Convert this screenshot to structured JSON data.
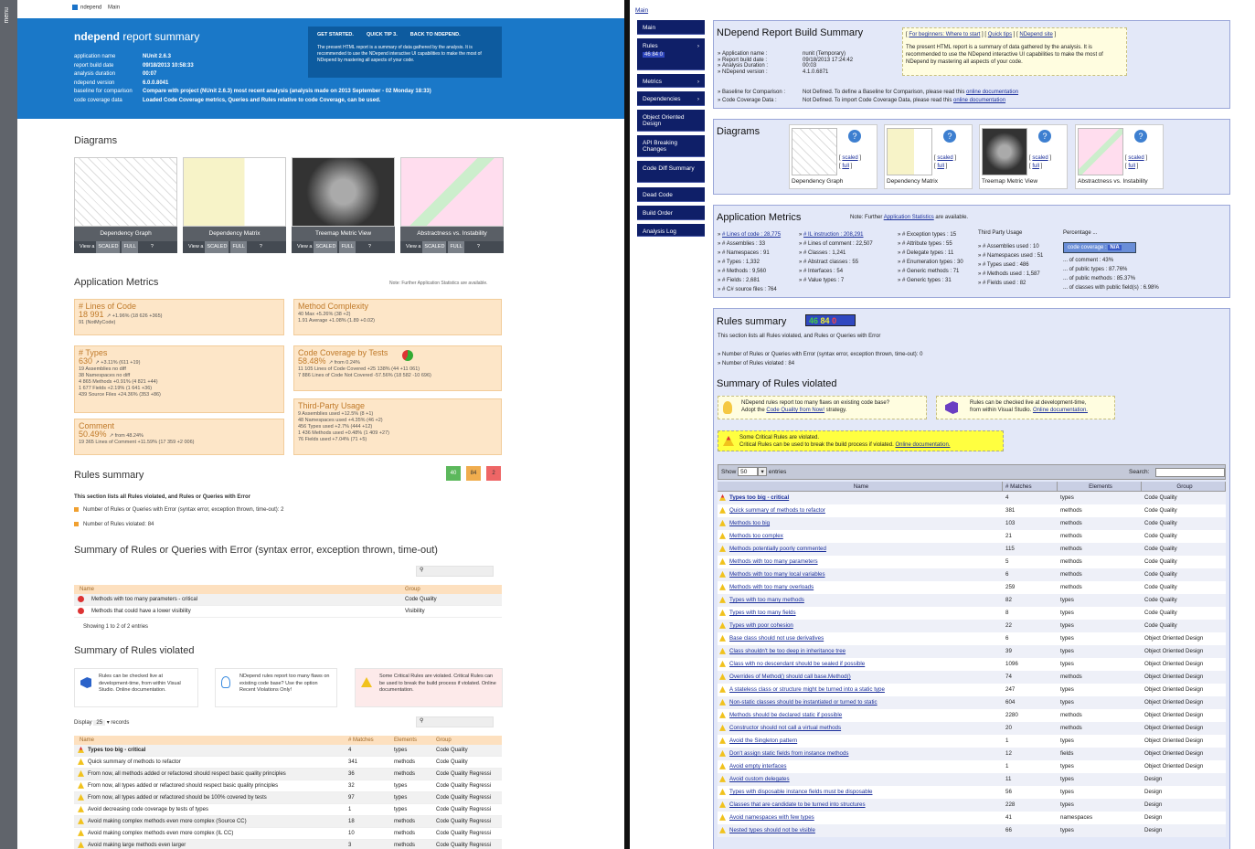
{
  "left": {
    "menu_label": "menu",
    "topnav": {
      "brand": "ndepend",
      "main": "Main"
    },
    "header": {
      "title_brand": "ndepend",
      "title_rest": " report summary",
      "info": [
        [
          "application name",
          "NUnit 2.6.3"
        ],
        [
          "report build date",
          "09/18/2013 10:58:33"
        ],
        [
          "analysis duration",
          "00:07"
        ],
        [
          "ndepend version",
          "6.0.0.8041"
        ],
        [
          "baseline for comparison",
          "Compare with project (NUnit 2.6.3) most recent analysis (analysis made on 2013  September - 02 Monday 18:33)"
        ],
        [
          "code coverage data",
          "Loaded Code Coverage metrics, Queries and Rules relative to code Coverage, can be used."
        ]
      ],
      "tabs": [
        "GET STARTED.",
        "QUICK TIP 3.",
        "BACK TO NDEPEND."
      ],
      "box_text": "The present HTML report is a summary of data gathered by the analysis. It is recommended to use the NDepend interactive UI capabilities to make the most of NDepend by mastering all aspects of your code."
    },
    "diagrams": {
      "title": "Diagrams",
      "items": [
        {
          "cap": "Dependency Graph"
        },
        {
          "cap": "Dependency Matrix"
        },
        {
          "cap": "Treemap Metric View"
        },
        {
          "cap": "Abstractness vs. Instability"
        }
      ],
      "view": "View a",
      "scaled": "SCALED",
      "full": "FULL",
      "help": "?"
    },
    "metrics": {
      "title": "Application Metrics",
      "note": "Note: Further Application Statistics are available.",
      "loc": {
        "t": "# Lines of Code",
        "v": "18 991",
        "d": "+1.96% (18 626 +365)",
        "s": "91 (NotMyCode)"
      },
      "types": {
        "t": "# Types",
        "v": "630",
        "d": "+3.11% (611 +19)",
        "lines": [
          "19   Assemblies         no diff",
          "38   Namespaces         no diff",
          "4 865   Methods    +0.91% (4 821 +44)",
          "1 677   Fields    +2.19% (1 641 +36)",
          "439   Source Files    +24.36% (353 +86)"
        ]
      },
      "comment": {
        "t": "Comment",
        "v": "50.49%",
        "d": "from 48.24%",
        "s": "19 365   Lines of Comment     +11.59% (17 359 +2 006)"
      },
      "complexity": {
        "t": "Method Complexity",
        "lines": [
          "40   Max      +5.26% (38 +2)",
          "1.91   Average    +1.08% (1.89 +0.02)"
        ]
      },
      "coverage": {
        "t": "Code Coverage by Tests",
        "v": "58.48%",
        "d": "from 0.24%",
        "lines": [
          "11 105   Lines of Code Covered     +25 138% (44 +11 061)",
          "7 886   Lines of Code Not Covered    -57.56% (18 582 -10 696)"
        ]
      },
      "thirdparty": {
        "t": "Third-Party Usage",
        "lines": [
          "9   Assemblies used    +12.5% (8 +1)",
          "48   Namespaces used    +4.35% (46 +2)",
          "456   Types used    +2.7% (444 +12)",
          "1 436   Methods used    +0.48% (1 409 +27)",
          "76   Fields used    +7.04% (71 +5)"
        ]
      }
    },
    "rules": {
      "title": "Rules summary",
      "chips": [
        "40",
        "84",
        "2"
      ],
      "desc": "This section lists all Rules violated, and Rules or Queries with Error",
      "items": [
        "Number of Rules or Queries with Error (syntax error, exception thrown, time-out): 2",
        "Number of Rules violated: 84"
      ]
    },
    "errors": {
      "title": "Summary of Rules or Queries with Error (syntax error, exception thrown, time-out)",
      "cols": [
        "Name",
        "Group"
      ],
      "rows": [
        [
          "Methods with too many parameters - critical",
          "Code Quality"
        ],
        [
          "Methods that could have a lower visibility",
          "Visibility"
        ]
      ],
      "showing": "Showing 1 to 2 of 2 entries"
    },
    "violated": {
      "title": "Summary of Rules violated",
      "tips": [
        "Rules can be checked live at development-time, from within Visual Studio. Online documentation.",
        "NDepend rules report too many flaws on existing code base? Use the option Recent Violations Only!",
        "Some Critical Rules are violated. Critical Rules can be used to break the build process if violated. Online documentation."
      ],
      "display": "Display",
      "display_n": "25",
      "records": "records",
      "cols": [
        "Name",
        "# Matches",
        "Elements",
        "Group"
      ],
      "rows": [
        [
          "Types too big - critical",
          "4",
          "types",
          "Code Quality"
        ],
        [
          "Quick summary of methods to refactor",
          "341",
          "methods",
          "Code Quality"
        ],
        [
          "From now, all methods added or refactored should respect basic quality principles",
          "36",
          "methods",
          "Code Quality Regressi"
        ],
        [
          "From now, all types added or refactored should respect basic quality principles",
          "32",
          "types",
          "Code Quality Regressi"
        ],
        [
          "From now, all types added or refactored should be 100% covered by tests",
          "97",
          "types",
          "Code Quality Regressi"
        ],
        [
          "Avoid decreasing code coverage by tests of types",
          "1",
          "types",
          "Code Quality Regressi"
        ],
        [
          "Avoid making complex methods even more complex (Source CC)",
          "18",
          "methods",
          "Code Quality Regressi"
        ],
        [
          "Avoid making complex methods even more complex (IL CC)",
          "10",
          "methods",
          "Code Quality Regressi"
        ],
        [
          "Avoid making large methods even larger",
          "3",
          "methods",
          "Code Quality Regressi"
        ]
      ]
    }
  },
  "right": {
    "main_link": "Main",
    "nav": [
      {
        "label": "Main"
      },
      {
        "label": "Rules",
        "badge": "46 84 0"
      },
      {
        "label": "Metrics"
      },
      {
        "label": "Dependencies"
      },
      {
        "label": "Object Oriented Design"
      },
      {
        "label": "API Breaking Changes"
      },
      {
        "label": "Code Diff Summary"
      },
      {
        "label": "Dead Code"
      },
      {
        "label": "Build Order"
      },
      {
        "label": "Analysis Log"
      }
    ],
    "summary": {
      "title": "NDepend Report Build Summary",
      "links": [
        "For beginners: Where to start",
        "Quick tips",
        "NDepend site"
      ],
      "box_text": "The present HTML report is a summary of data gathered by the analysis. It is recommended to use the NDepend interactive UI capabilities to make the most of NDepend by mastering all aspects of your code.",
      "info": [
        [
          "Application name :",
          "nunit (Temporary)"
        ],
        [
          "Report build date :",
          "09/18/2013 17:24:42"
        ],
        [
          "Analysis Duration :",
          "00:03"
        ],
        [
          "NDepend version :",
          "4.1.0.6871"
        ]
      ],
      "baseline": [
        "Baseline for Comparison :",
        "Not Defined. To define a Baseline for Comparison, please read this",
        "online documentation"
      ],
      "coverage": [
        "Code Coverage Data :",
        "Not Defined. To import Code Coverage Data, please read this",
        "online documentation"
      ]
    },
    "diagrams": {
      "title": "Diagrams",
      "items": [
        "Dependency Graph",
        "Dependency Matrix",
        "Treemap Metric View",
        "Abstractness vs. Instability"
      ],
      "scaled": "scaled",
      "full": "full"
    },
    "metrics": {
      "title": "Application Metrics",
      "note": "Note: Further",
      "note_link": "Application Statistics",
      "note_end": "are available.",
      "c1": [
        "# Lines of code : 28,775",
        "# Assemblies : 33",
        "# Namespaces : 91",
        "# Types : 1,332",
        "# Methods : 9,560",
        "# Fields : 2,681",
        "# C# source files : 764"
      ],
      "c2": [
        "# IL instruction : 208,291",
        "# Lines of comment : 22,507",
        "# Classes : 1,241",
        "# Abstract classes : 55",
        "# Interfaces : 54",
        "# Value types : 7"
      ],
      "c3": [
        "# Exception types : 15",
        "# Attribute types : 55",
        "# Delegate types : 11",
        "# Enumeration types : 30",
        "# Generic methods : 71",
        "# Generic types : 31"
      ],
      "c4t": "Third Party Usage",
      "c4": [
        "# Assemblies used : 10",
        "# Namespaces used : 51",
        "# Types used : 486",
        "# Methods used : 1,587",
        "# Fields used : 82"
      ],
      "c5t": "Percentage ...",
      "c5cov": "code coverage :",
      "c5covv": "N/A",
      "c5": [
        "... of comment : 43%",
        "... of public types : 87.76%",
        "... of public methods : 85.37%",
        "... of classes with public field(s) : 6.98%"
      ]
    },
    "rules": {
      "title": "Rules summary",
      "badge": [
        "46",
        "84",
        "0"
      ],
      "desc": "This section lists all Rules violated, and Rules or Queries with Error",
      "items": [
        "Number of Rules or Queries with Error (syntax error, exception thrown, time-out): 0",
        "Number of Rules violated : 84"
      ],
      "vtitle": "Summary of Rules violated",
      "tip1": [
        "NDepend rules report too many flaws on existing code base?",
        "Adopt the",
        "Code Quality from Now!",
        "strategy."
      ],
      "tip2": [
        "Rules can be checked live at development-time,",
        "from within Visual Studio.",
        "Online documentation."
      ],
      "crit": [
        "Some Critical Rules are violated.",
        "Critical Rules can be used to break the build process if violated.",
        "Online documentation."
      ],
      "show": "Show",
      "show_n": "50",
      "entries": "entries",
      "search": "Search:",
      "cols": [
        "Name",
        "# Matches",
        "Elements",
        "Group"
      ],
      "rows": [
        [
          "Types too big - critical",
          "4",
          "types",
          "Code Quality"
        ],
        [
          "Quick summary of methods to refactor",
          "381",
          "methods",
          "Code Quality"
        ],
        [
          "Methods too big",
          "103",
          "methods",
          "Code Quality"
        ],
        [
          "Methods too complex",
          "21",
          "methods",
          "Code Quality"
        ],
        [
          "Methods potentially poorly commented",
          "115",
          "methods",
          "Code Quality"
        ],
        [
          "Methods with too many parameters",
          "5",
          "methods",
          "Code Quality"
        ],
        [
          "Methods with too many local variables",
          "6",
          "methods",
          "Code Quality"
        ],
        [
          "Methods with too many overloads",
          "259",
          "methods",
          "Code Quality"
        ],
        [
          "Types with too many methods",
          "82",
          "types",
          "Code Quality"
        ],
        [
          "Types with too many fields",
          "8",
          "types",
          "Code Quality"
        ],
        [
          "Types with poor cohesion",
          "22",
          "types",
          "Code Quality"
        ],
        [
          "Base class should not use derivatives",
          "6",
          "types",
          "Object Oriented Design"
        ],
        [
          "Class shouldn't be too deep in inheritance tree",
          "39",
          "types",
          "Object Oriented Design"
        ],
        [
          "Class with no descendant should be sealed if possible",
          "1096",
          "types",
          "Object Oriented Design"
        ],
        [
          "Overrides of Method() should call base.Method()",
          "74",
          "methods",
          "Object Oriented Design"
        ],
        [
          "A stateless class or structure might be turned into a static type",
          "247",
          "types",
          "Object Oriented Design"
        ],
        [
          "Non-static classes should be instantiated or turned to static",
          "604",
          "types",
          "Object Oriented Design"
        ],
        [
          "Methods should be declared static if possible",
          "2280",
          "methods",
          "Object Oriented Design"
        ],
        [
          "Constructor should not call a virtual methods",
          "20",
          "methods",
          "Object Oriented Design"
        ],
        [
          "Avoid the Singleton pattern",
          "1",
          "types",
          "Object Oriented Design"
        ],
        [
          "Don't assign static fields from instance methods",
          "12",
          "fields",
          "Object Oriented Design"
        ],
        [
          "Avoid empty interfaces",
          "1",
          "types",
          "Object Oriented Design"
        ],
        [
          "Avoid custom delegates",
          "11",
          "types",
          "Design"
        ],
        [
          "Types with disposable instance fields must be disposable",
          "56",
          "types",
          "Design"
        ],
        [
          "Classes that are candidate to be turned into structures",
          "228",
          "types",
          "Design"
        ],
        [
          "Avoid namespaces with few types",
          "41",
          "namespaces",
          "Design"
        ],
        [
          "Nested types should not be visible",
          "66",
          "types",
          "Design"
        ]
      ]
    }
  }
}
